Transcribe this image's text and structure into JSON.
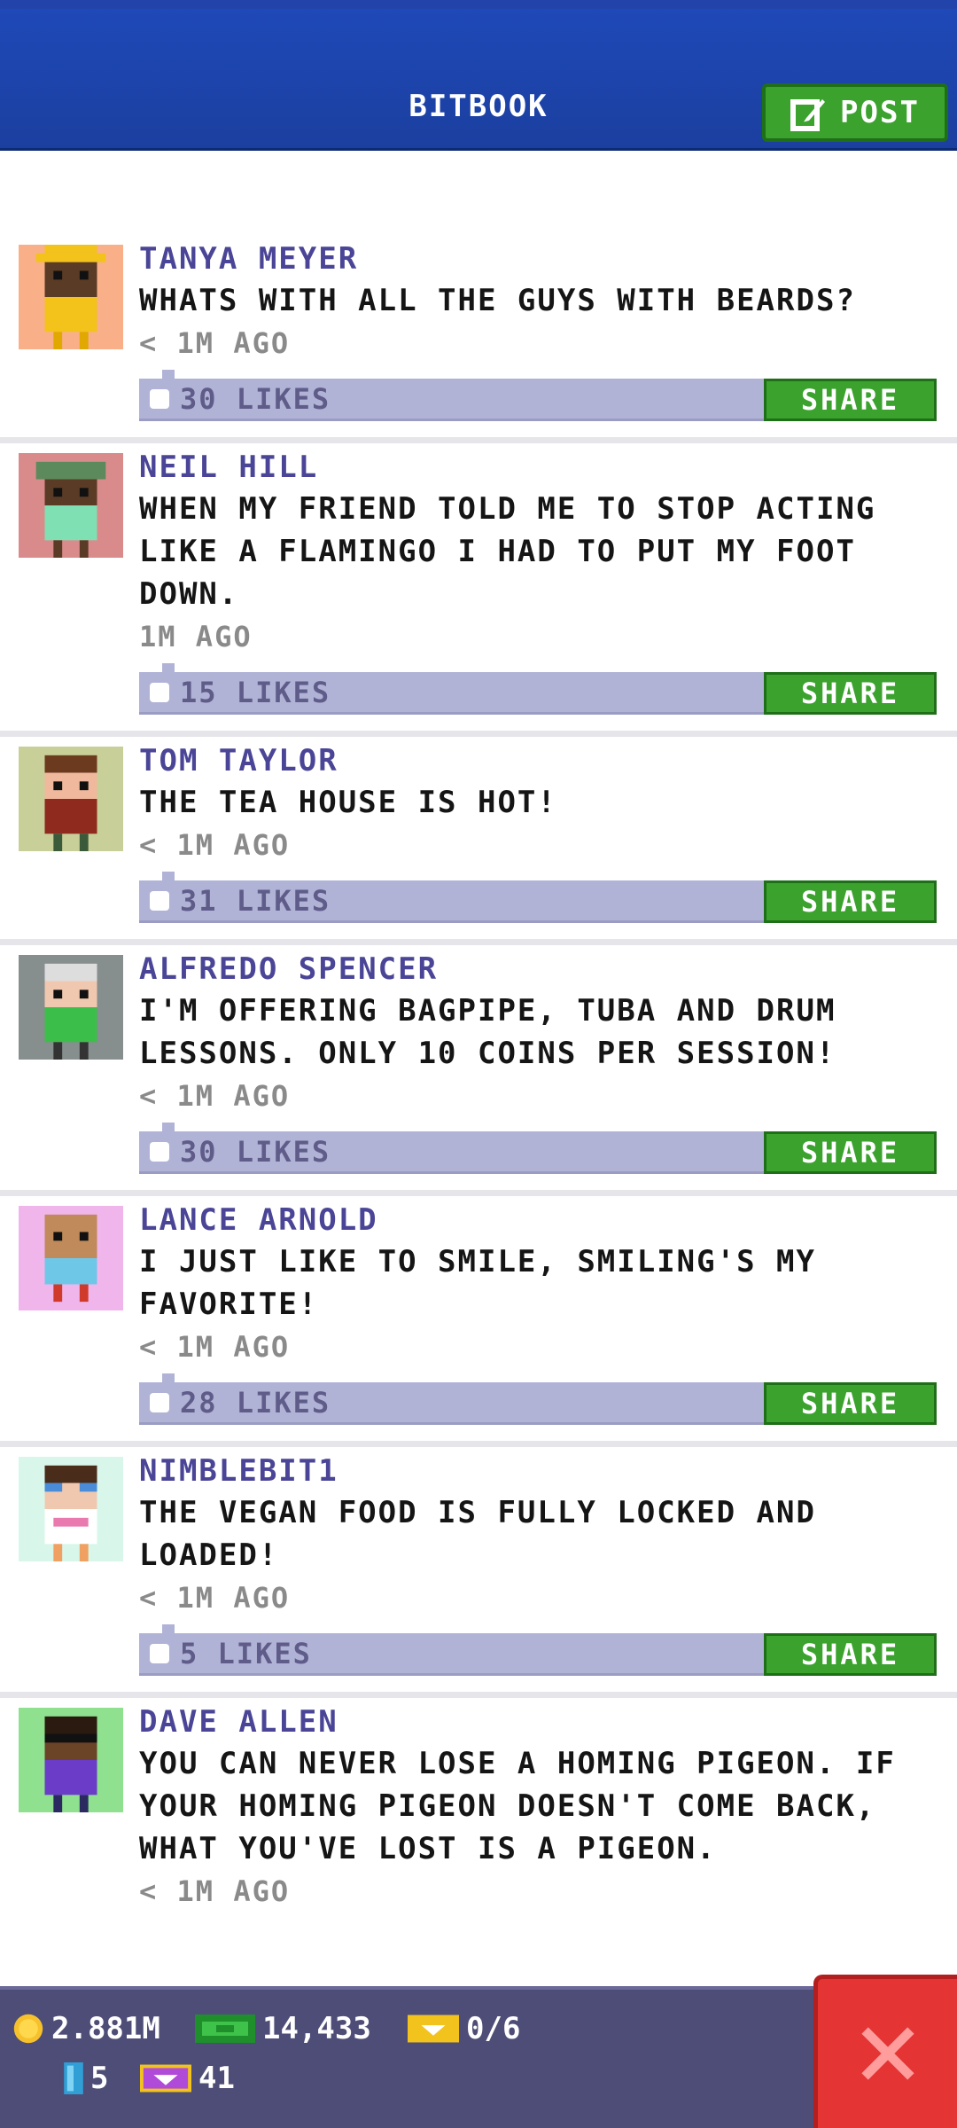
{
  "header": {
    "title": "BITBOOK",
    "post_label": "POST"
  },
  "posts": [
    {
      "author": "TANYA MEYER",
      "message": "WHATS WITH ALL THE GUYS WITH BEARDS?",
      "time": "< 1M AGO",
      "likes": "30 LIKES",
      "share": "SHARE",
      "avatar_bg": "#f9b089"
    },
    {
      "author": "NEIL HILL",
      "message": "WHEN MY FRIEND TOLD ME TO STOP ACTING LIKE A FLAMINGO I HAD TO PUT MY FOOT DOWN.",
      "time": "1M AGO",
      "likes": "15 LIKES",
      "share": "SHARE",
      "avatar_bg": "#d98b8b"
    },
    {
      "author": "TOM TAYLOR",
      "message": "THE TEA HOUSE IS HOT!",
      "time": "< 1M AGO",
      "likes": "31 LIKES",
      "share": "SHARE",
      "avatar_bg": "#c9cf98"
    },
    {
      "author": "ALFREDO SPENCER",
      "message": "I'M OFFERING BAGPIPE, TUBA AND DRUM LESSONS. ONLY 10 COINS PER SESSION!",
      "time": "< 1M AGO",
      "likes": "30 LIKES",
      "share": "SHARE",
      "avatar_bg": "#868e8e"
    },
    {
      "author": "LANCE ARNOLD",
      "message": "I JUST LIKE TO SMILE, SMILING'S MY FAVORITE!",
      "time": "< 1M AGO",
      "likes": "28 LIKES",
      "share": "SHARE",
      "avatar_bg": "#f0b6ec"
    },
    {
      "author": "NIMBLEBIT1",
      "message": "THE VEGAN FOOD IS FULLY LOCKED AND LOADED!",
      "time": "< 1M AGO",
      "likes": "5 LIKES",
      "share": "SHARE",
      "avatar_bg": "#d8f7ea"
    },
    {
      "author": "DAVE ALLEN",
      "message": "YOU CAN NEVER LOSE A HOMING PIGEON. IF YOUR HOMING PIGEON DOESN'T COME BACK, WHAT YOU'VE LOST IS A PIGEON.",
      "time": "< 1M AGO",
      "likes": "",
      "share": "",
      "avatar_bg": "#8fe08f"
    }
  ],
  "footer": {
    "coins": "2.881M",
    "bux": "14,433",
    "tickets": "0/6",
    "keys": "5",
    "gems": "41"
  },
  "colors": {
    "header_blue": "#1f49b8",
    "share_green": "#3aa22d",
    "close_red": "#e53434"
  }
}
